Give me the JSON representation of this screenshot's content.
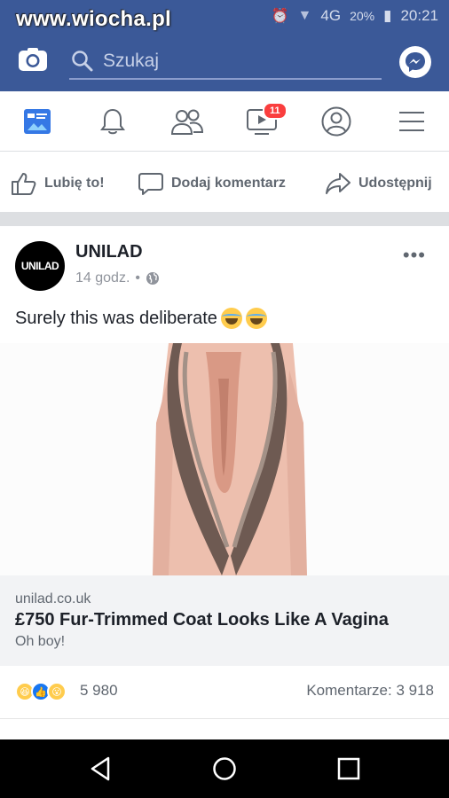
{
  "watermark": "www.wiocha.pl",
  "status": {
    "network": "4G",
    "battery": "20%",
    "time": "20:21"
  },
  "topbar": {
    "search_placeholder": "Szukaj",
    "camera_icon": "camera-icon",
    "messenger_icon": "messenger-icon"
  },
  "nav": {
    "items": [
      "news-feed-icon",
      "notifications-bell-icon",
      "friends-icon",
      "watch-video-icon",
      "profile-icon",
      "menu-icon"
    ],
    "watch_badge": "11"
  },
  "actions": {
    "like": "Lubię to!",
    "comment": "Dodaj komentarz",
    "share": "Udostępnij"
  },
  "post": {
    "author": "UNILAD",
    "avatar_text": "UNILAD",
    "time": "14 godz.",
    "separator": "•",
    "text": "Surely this was deliberate",
    "link": {
      "domain": "unilad.co.uk",
      "title": "£750 Fur-Trimmed Coat Looks Like A Vagina",
      "subtitle": "Oh boy!"
    },
    "reaction_count": "5 980",
    "comments": "Komentarze: 3 918"
  },
  "colors": {
    "brand": "#3b5998",
    "badge": "#fa3e3e",
    "link_bg": "#f2f3f5"
  }
}
